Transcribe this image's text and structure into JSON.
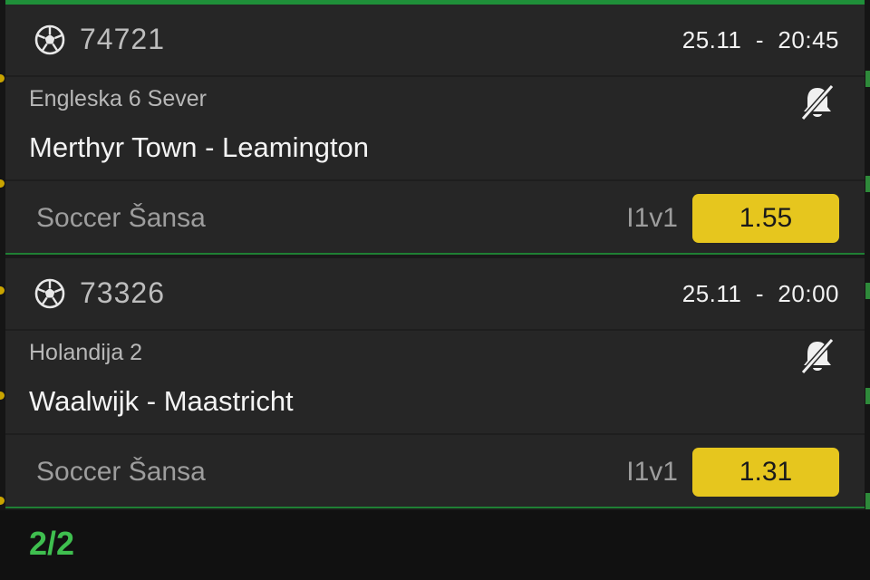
{
  "matches": [
    {
      "id": "74721",
      "datetime": "25.11  -  20:45",
      "league": "Engleska 6 Sever",
      "teams": "Merthyr Town - Leamington",
      "bet_type": "Soccer Šansa",
      "bet_code": "I1v1",
      "odds": "1.55",
      "sport_icon": "soccer-ball-icon",
      "notify_icon": "bell-off-icon"
    },
    {
      "id": "73326",
      "datetime": "25.11  -  20:00",
      "league": "Holandija 2",
      "teams": "Waalwijk - Maastricht",
      "bet_type": "Soccer Šansa",
      "bet_code": "I1v1",
      "odds": "1.31",
      "sport_icon": "soccer-ball-icon",
      "notify_icon": "bell-off-icon"
    }
  ],
  "footer": {
    "count": "2/2"
  },
  "colors": {
    "accent_green": "#1f8f39",
    "odds_yellow": "#e6c61e",
    "card_bg": "#262626",
    "count_green": "#3fbf4f"
  }
}
